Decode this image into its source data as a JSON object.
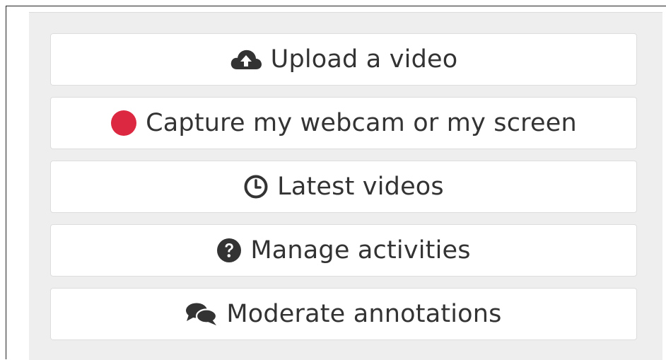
{
  "menu": {
    "items": [
      {
        "label": "Upload a video",
        "icon": "cloud-upload-icon"
      },
      {
        "label": "Capture my webcam or my screen",
        "icon": "record-icon"
      },
      {
        "label": "Latest videos",
        "icon": "clock-icon"
      },
      {
        "label": "Manage activities",
        "icon": "question-circle-icon"
      },
      {
        "label": "Moderate annotations",
        "icon": "comments-icon"
      }
    ]
  },
  "colors": {
    "record": "#dc2840",
    "icon": "#333333",
    "text": "#333333",
    "panel": "#eeeeee",
    "button": "#ffffff"
  }
}
